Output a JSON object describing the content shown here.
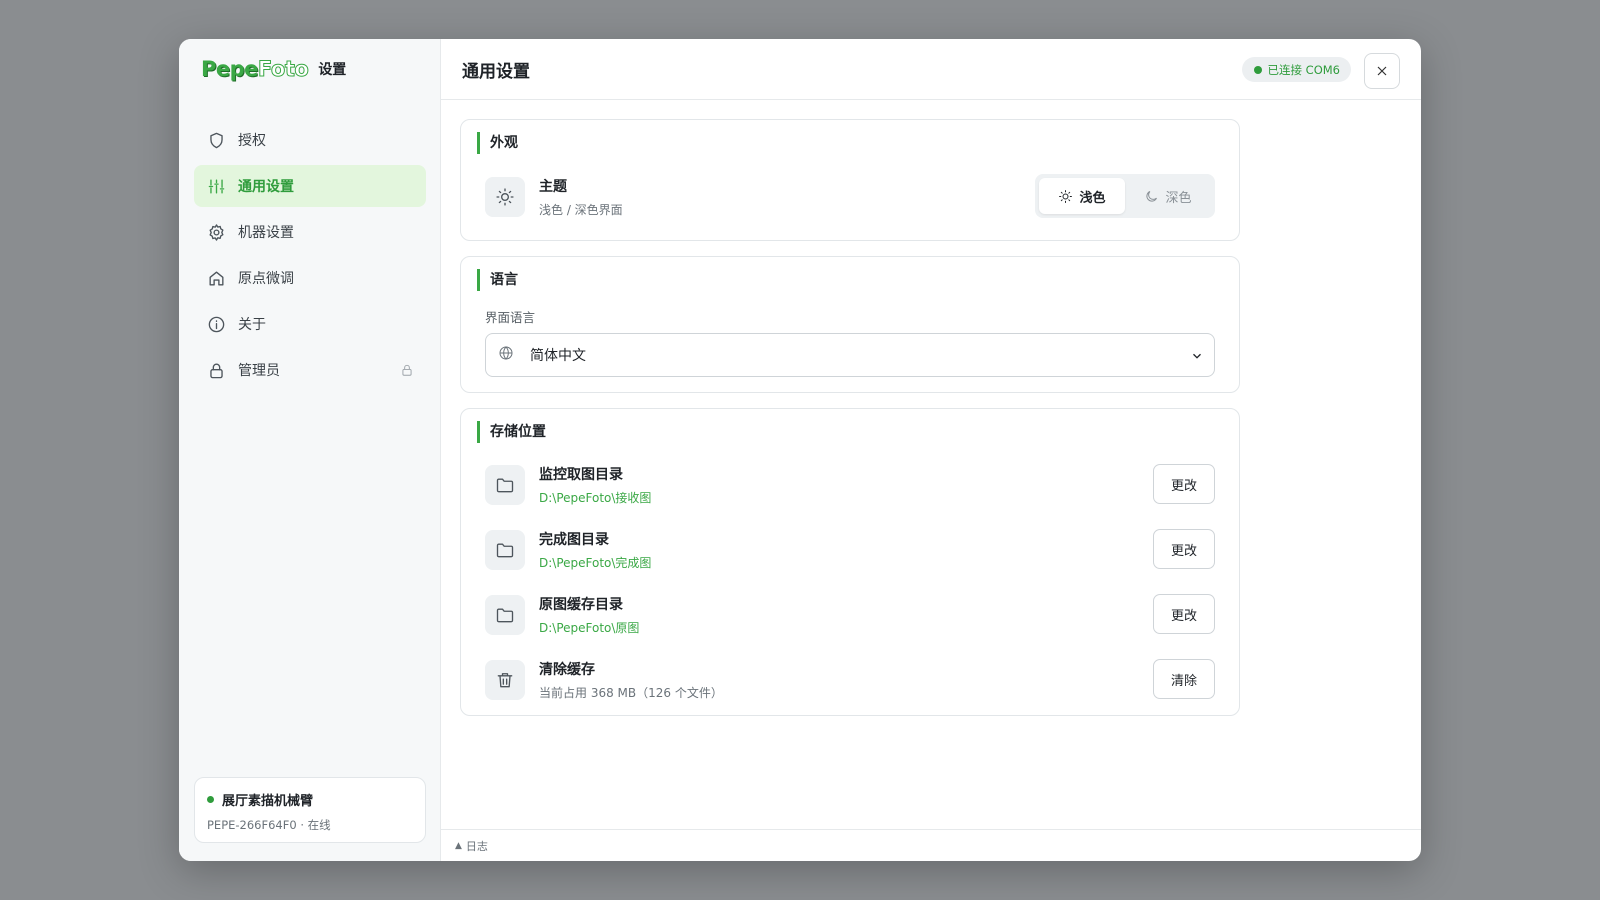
{
  "brand": {
    "logo_a": "Pepe",
    "logo_b": "Foto",
    "title": "设置"
  },
  "sidebar": {
    "items": [
      {
        "label": "授权",
        "icon": "shield-icon"
      },
      {
        "label": "通用设置",
        "icon": "sliders-icon",
        "active": true
      },
      {
        "label": "机器设置",
        "icon": "gear-icon"
      },
      {
        "label": "原点微调",
        "icon": "home-icon"
      },
      {
        "label": "关于",
        "icon": "info-icon"
      },
      {
        "label": "管理员",
        "icon": "lock-icon",
        "locked": true
      }
    ],
    "device": {
      "name": "展厅素描机械臂",
      "sub": "PEPE-266F64F0 · 在线",
      "status_color": "#2f9c3c"
    }
  },
  "header": {
    "title": "通用设置",
    "status": "已连接 COM6"
  },
  "appearance": {
    "section": "外观",
    "theme_title": "主题",
    "theme_sub": "浅色 / 深色界面",
    "light": "浅色",
    "dark": "深色",
    "selected": "浅色"
  },
  "language": {
    "section": "语言",
    "field_label": "界面语言",
    "value": "简体中文"
  },
  "storage": {
    "section": "存储位置",
    "rows": [
      {
        "title": "监控取图目录",
        "sub": "D:\\PepeFoto\\接收图",
        "button": "更改",
        "icon": "folder-icon"
      },
      {
        "title": "完成图目录",
        "sub": "D:\\PepeFoto\\完成图",
        "button": "更改",
        "icon": "folder-icon"
      },
      {
        "title": "原图缓存目录",
        "sub": "D:\\PepeFoto\\原图",
        "button": "更改",
        "icon": "folder-icon"
      },
      {
        "title": "清除缓存",
        "sub": "当前占用 368 MB（126 个文件）",
        "button": "清除",
        "icon": "trash-icon"
      }
    ]
  },
  "footer": {
    "label": "日志",
    "toggle_glyph": "▲"
  },
  "colors": {
    "accent": "#3aa845",
    "accent_bg": "#e3f6dd",
    "backdrop": "#8a8d90"
  }
}
